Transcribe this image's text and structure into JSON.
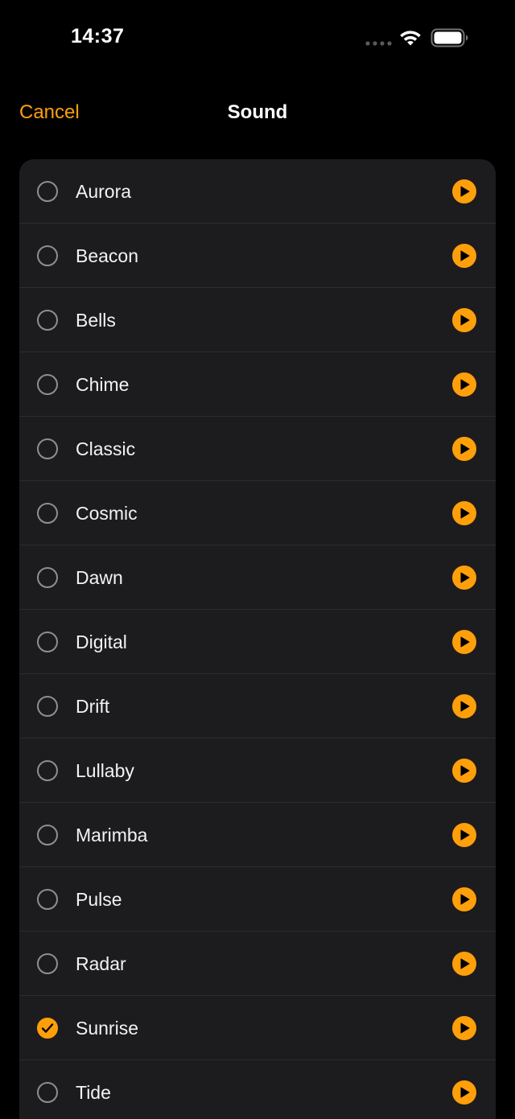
{
  "status_bar": {
    "time": "14:37"
  },
  "nav": {
    "cancel_label": "Cancel",
    "title": "Sound"
  },
  "colors": {
    "accent": "#ff9f0a",
    "background": "#000000",
    "list_background": "#1c1c1e",
    "separator": "#2c2c2e",
    "radio_border": "#8e8e93"
  },
  "icons": {
    "radio": "radio-circle-icon",
    "checked": "checkmark-icon",
    "play": "play-icon",
    "wifi": "wifi-icon",
    "battery": "battery-icon",
    "signal": "signal-dots-icon"
  },
  "sounds": [
    {
      "label": "Aurora",
      "selected": false
    },
    {
      "label": "Beacon",
      "selected": false
    },
    {
      "label": "Bells",
      "selected": false
    },
    {
      "label": "Chime",
      "selected": false
    },
    {
      "label": "Classic",
      "selected": false
    },
    {
      "label": "Cosmic",
      "selected": false
    },
    {
      "label": "Dawn",
      "selected": false
    },
    {
      "label": "Digital",
      "selected": false
    },
    {
      "label": "Drift",
      "selected": false
    },
    {
      "label": "Lullaby",
      "selected": false
    },
    {
      "label": "Marimba",
      "selected": false
    },
    {
      "label": "Pulse",
      "selected": false
    },
    {
      "label": "Radar",
      "selected": false
    },
    {
      "label": "Sunrise",
      "selected": true
    },
    {
      "label": "Tide",
      "selected": false
    }
  ]
}
